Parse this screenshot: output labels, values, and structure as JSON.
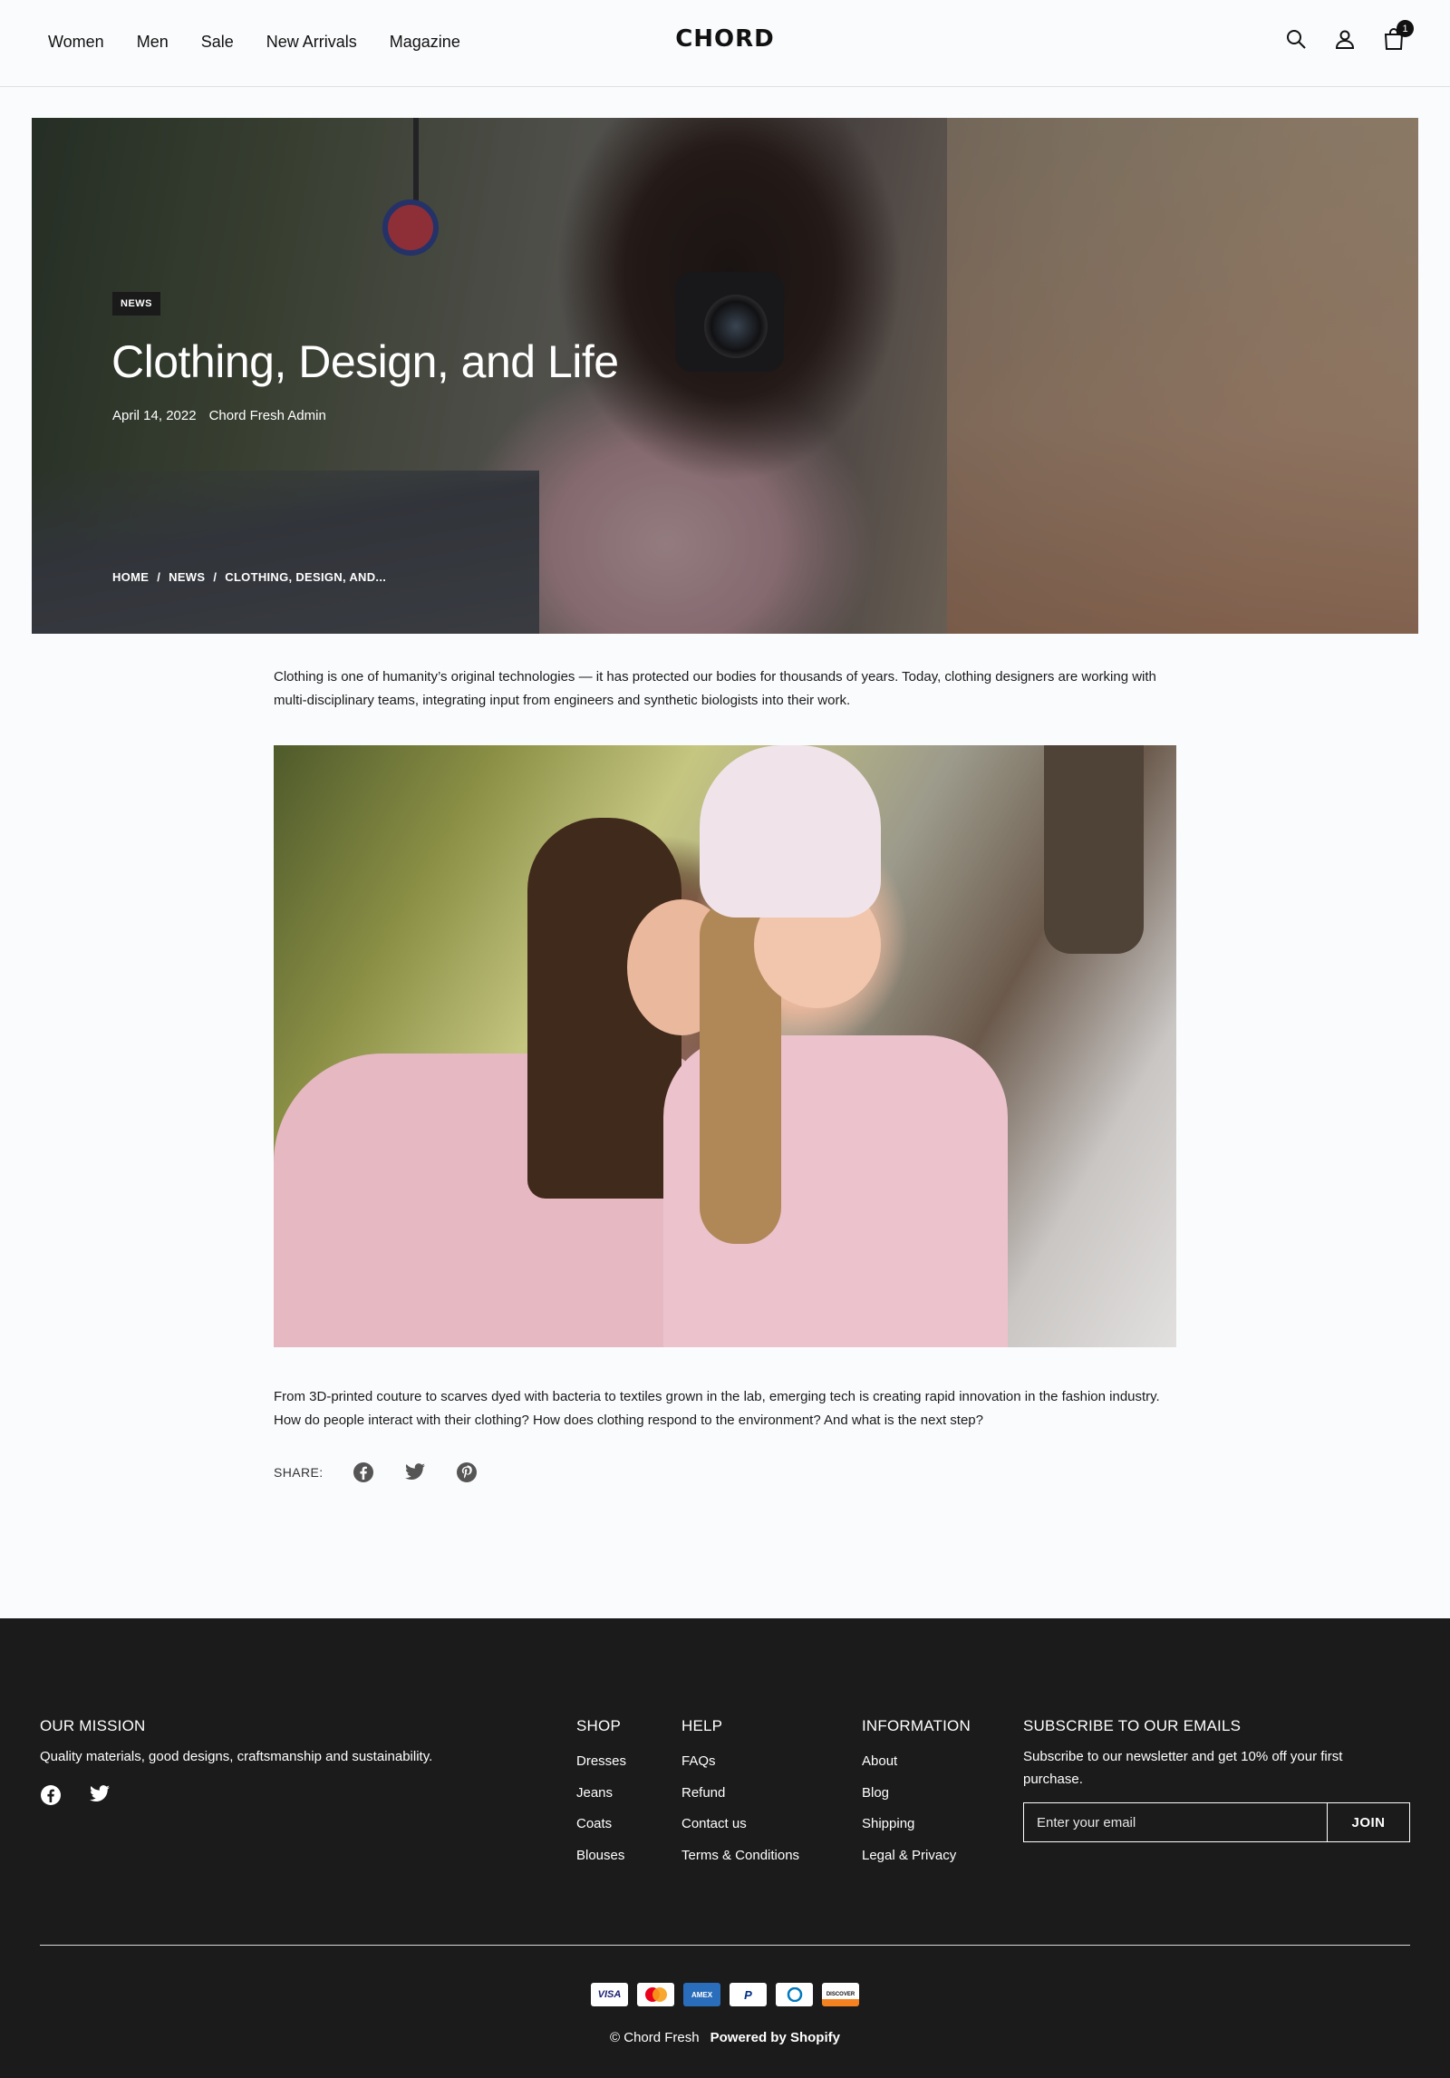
{
  "header": {
    "nav": [
      "Women",
      "Men",
      "Sale",
      "New Arrivals",
      "Magazine"
    ],
    "logo": "CHORD",
    "cart_count": "1",
    "icons": [
      "search-icon",
      "account-icon",
      "cart-icon"
    ]
  },
  "hero": {
    "badge": "NEWS",
    "title": "Clothing, Design, and Life",
    "date": "April 14, 2022",
    "author": "Chord Fresh Admin",
    "breadcrumb": [
      "HOME",
      "/",
      "NEWS",
      "/",
      "CLOTHING, DESIGN, AND..."
    ]
  },
  "article": {
    "intro": "Clothing is one of humanity’s original technologies — it has protected our bodies for thousands of years. Today, clothing designers are working with multi-disciplinary teams, integrating input from engineers and synthetic biologists into their work.",
    "body": "From 3D-printed couture to scarves dyed with bacteria to textiles grown in the lab, emerging tech is creating rapid innovation in the fashion industry. How do people interact with their clothing? How does clothing respond to the environment? And what is the next step?",
    "share_label": "SHARE:",
    "share_icons": [
      "facebook-icon",
      "twitter-icon",
      "pinterest-icon"
    ]
  },
  "footer": {
    "mission": {
      "heading": "OUR MISSION",
      "text": "Quality materials, good designs, craftsmanship and sustainability."
    },
    "shop": {
      "heading": "SHOP",
      "items": [
        "Dresses",
        "Jeans",
        "Coats",
        "Blouses"
      ]
    },
    "help": {
      "heading": "HELP",
      "items": [
        "FAQs",
        "Refund",
        "Contact us",
        "Terms & Conditions"
      ]
    },
    "information": {
      "heading": "INFORMATION",
      "items": [
        "About",
        "Blog",
        "Shipping",
        "Legal & Privacy"
      ]
    },
    "subscribe": {
      "heading": "SUBSCRIBE TO OUR EMAILS",
      "text": "Subscribe to our newsletter and get 10% off your first purchase.",
      "placeholder": "Enter your email",
      "button": "JOIN"
    },
    "payments": [
      {
        "label": "VISA",
        "color": "#1a1f71"
      },
      {
        "label": "",
        "color": "#eb001b"
      },
      {
        "label": "AMEX",
        "color": "#ffffff"
      },
      {
        "label": "P",
        "color": "#003087"
      },
      {
        "label": "D",
        "color": "#0079be"
      },
      {
        "label": "DISCOVER",
        "color": "#111111"
      }
    ],
    "copyright": "© Chord Fresh",
    "powered": "Powered by Shopify"
  }
}
